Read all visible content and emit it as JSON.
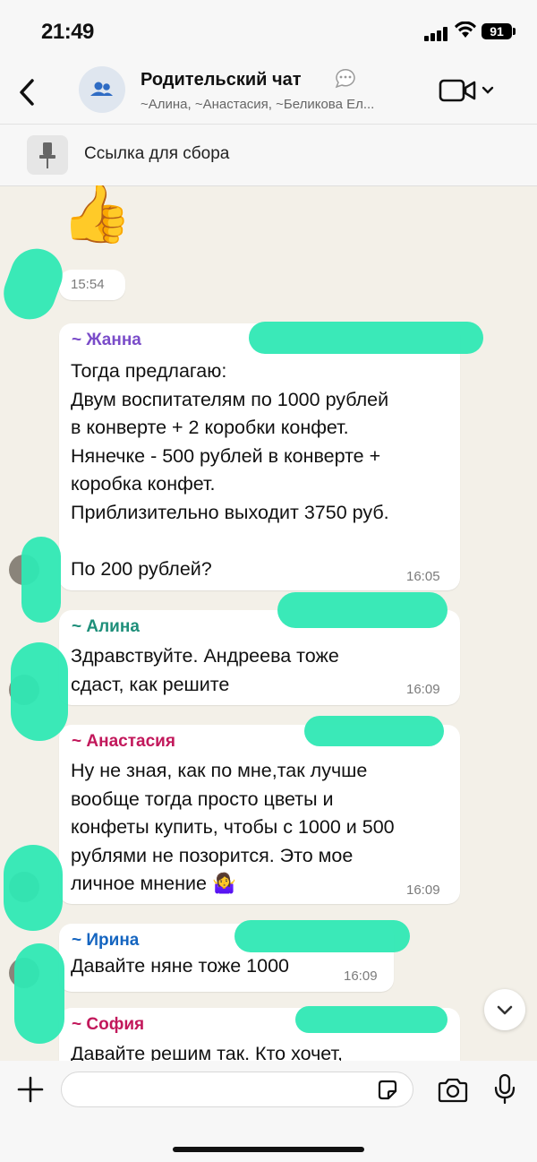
{
  "status_bar": {
    "time": "21:49",
    "battery": "91"
  },
  "header": {
    "back_label": "Back",
    "title": "Родительский чат",
    "members": "~Алина, ~Анастасия, ~Беликова Ел..."
  },
  "pinned": {
    "text": "Ссылка для сбора"
  },
  "messages": [
    {
      "type": "emoji",
      "emoji": "👍",
      "time": "15:54"
    },
    {
      "sender": "~ Жанна",
      "sender_color": "#7a4cc9",
      "text": "Тогда предлагаю:\nДвум воспитателям по 1000 рублей\nв конверте + 2 коробки конфет.\nНянечке - 500 рублей в конверте +\nкоробка конфет.\nПриблизительно выходит 3750 руб.\n\nПо 200 рублей?",
      "time": "16:05"
    },
    {
      "sender": "~ Алина",
      "sender_color": "#1e8f7a",
      "text": "Здравствуйте. Андреева тоже\nсдаст, как решите",
      "time": "16:09"
    },
    {
      "sender": "~ Анастасия",
      "sender_color": "#c2185b",
      "text": "Ну не зная, как по мне,так лучше\nвообще тогда просто цветы и\nконфеты купить, чтобы с 1000 и 500\nрублями не позорится. Это мое\nличное мнение 🤷‍♀️",
      "time": "16:09"
    },
    {
      "sender": "~ Ирина",
      "sender_color": "#1565c0",
      "text": "Давайте няне тоже 1000",
      "time": "16:09"
    },
    {
      "sender": "~ София",
      "sender_color": "#c2185b",
      "text": "Давайте решим так. Кто хочет,",
      "time": ""
    }
  ],
  "input": {
    "placeholder": ""
  },
  "colors": {
    "scribble": "#2fe8b4",
    "background": "#f3f0e8"
  }
}
